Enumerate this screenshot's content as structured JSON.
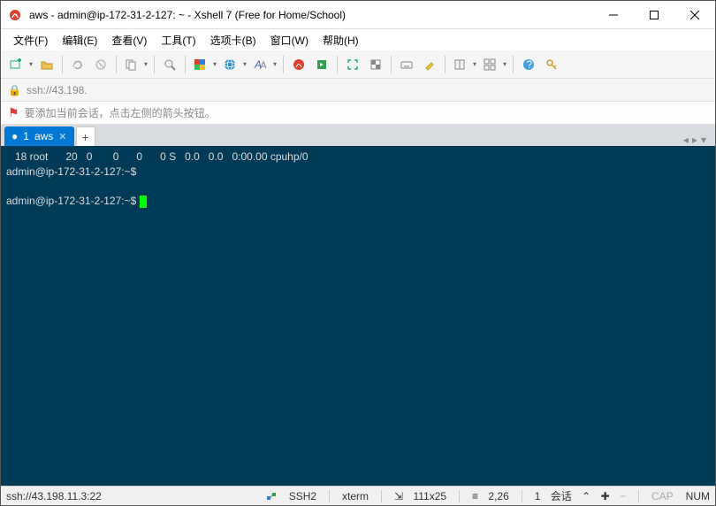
{
  "window": {
    "title": "aws - admin@ip-172-31-2-127: ~ - Xshell 7 (Free for Home/School)"
  },
  "menu": {
    "file": "文件(F)",
    "edit": "编辑(E)",
    "view": "查看(V)",
    "tools": "工具(T)",
    "tabs": "选项卡(B)",
    "window": "窗口(W)",
    "help": "帮助(H)"
  },
  "addressbar": {
    "url": "ssh://43.198."
  },
  "hint": {
    "text": "要添加当前会话，点击左侧的箭头按钮。"
  },
  "tabs": {
    "active": {
      "index": "1",
      "label": "aws"
    },
    "add": "+"
  },
  "terminal": {
    "line1": "   18 root      20   0       0      0      0 S   0.0   0.0   0:00.00 cpuhp/0",
    "line2": "admin@ip-172-31-2-127:~$",
    "line3": "admin@ip-172-31-2-127:~$ "
  },
  "status": {
    "address": "ssh://43.198.11.3:22",
    "protocol": "SSH2",
    "termtype": "xterm",
    "size": "111x25",
    "pos": "2,26",
    "sessions_n": "1",
    "sessions_label": "会话",
    "cap": "CAP",
    "num": "NUM"
  }
}
